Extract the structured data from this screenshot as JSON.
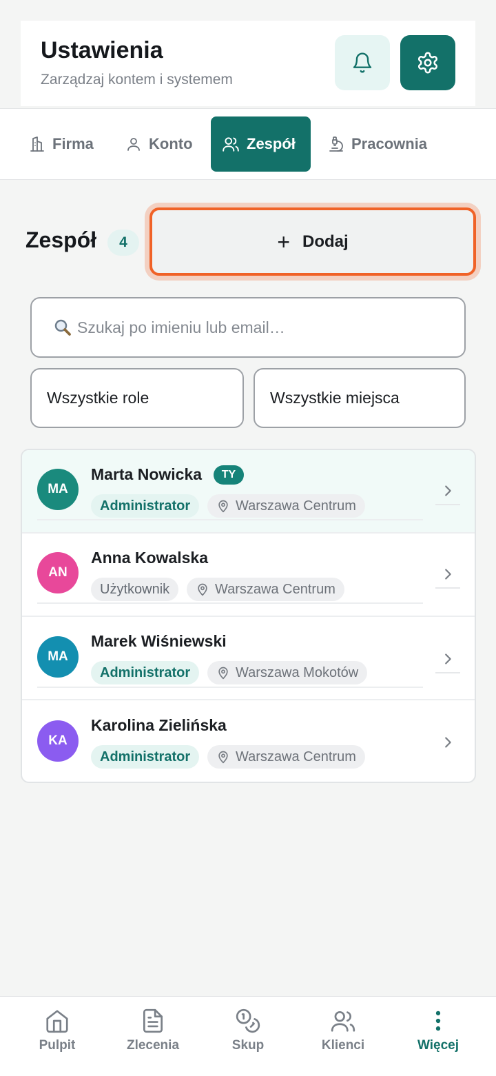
{
  "header": {
    "title": "Ustawienia",
    "subtitle": "Zarządzaj kontem i systemem",
    "bell_icon": "bell-icon",
    "gear_icon": "gear-icon"
  },
  "tabs": [
    {
      "label": "Firma",
      "icon": "building-icon",
      "active": false
    },
    {
      "label": "Konto",
      "icon": "user-icon",
      "active": false
    },
    {
      "label": "Zespół",
      "icon": "users-icon",
      "active": true
    },
    {
      "label": "Pracownia",
      "icon": "microscope-icon",
      "active": false
    }
  ],
  "team": {
    "title": "Zespół",
    "count": "4",
    "add_label": "Dodaj"
  },
  "search": {
    "placeholder": "Szukaj po imieniu lub email…"
  },
  "filters": {
    "roles": "Wszystkie role",
    "places": "Wszystkie miejsca"
  },
  "members": [
    {
      "initials": "MA",
      "name": "Marta Nowicka",
      "you_badge": "TY",
      "role": "Administrator",
      "location": "Warszawa Centrum",
      "avatar_color": "#1a8a7d"
    },
    {
      "initials": "AN",
      "name": "Anna Kowalska",
      "role": "Użytkownik",
      "location": "Warszawa Centrum",
      "avatar_color": "#e8489a"
    },
    {
      "initials": "MA",
      "name": "Marek Wiśniewski",
      "role": "Administrator",
      "location": "Warszawa Mokotów",
      "avatar_color": "#138fb0"
    },
    {
      "initials": "KA",
      "name": "Karolina Zielińska",
      "role": "Administrator",
      "location": "Warszawa Centrum",
      "avatar_color": "#8b5cf0"
    }
  ],
  "nav": [
    {
      "label": "Pulpit",
      "icon": "home-icon",
      "active": false
    },
    {
      "label": "Zlecenia",
      "icon": "document-icon",
      "active": false
    },
    {
      "label": "Skup",
      "icon": "coins-icon",
      "active": false
    },
    {
      "label": "Klienci",
      "icon": "users-icon",
      "active": false
    },
    {
      "label": "Więcej",
      "icon": "more-vertical-icon",
      "active": true
    }
  ],
  "colors": {
    "accent": "#137169",
    "highlight": "#f06227"
  }
}
